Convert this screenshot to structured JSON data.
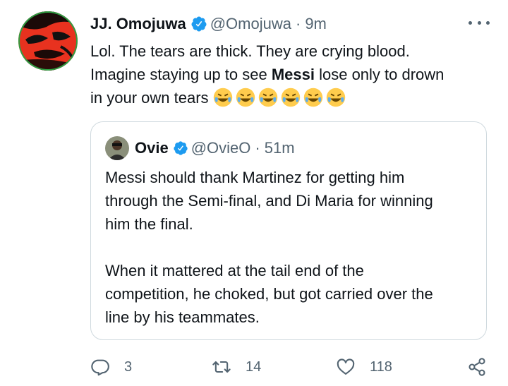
{
  "tweet": {
    "author_name": "JJ. Omojuwa",
    "handle": "@Omojuwa",
    "separator": "·",
    "time": "9m",
    "text_line1": "Lol. The tears are thick. They are crying blood.",
    "text_line2_pre": "Imagine staying up to see ",
    "text_line2_bold": "Messi",
    "text_line2_post": " lose only to drown",
    "text_line3": "in your own tears",
    "emojis": "😂😂😂😂😂😂"
  },
  "quote": {
    "author_name": "Ovie",
    "handle": "@OvieO",
    "separator": "·",
    "time": "51m",
    "p1_line1": "Messi should thank Martinez for getting him",
    "p1_line2": "through the Semi-final, and Di Maria for winning",
    "p1_line3": "him the final.",
    "p2_line1": "When it mattered at the tail end of the",
    "p2_line2": "competition, he choked, but got carried over the",
    "p2_line3": "line by his teammates."
  },
  "actions": {
    "replies": "3",
    "retweets": "14",
    "likes": "118"
  },
  "colors": {
    "verified": "#1d9bf0",
    "muted": "#536471",
    "border": "#cfd9de"
  },
  "icons": [
    "verified-badge-icon",
    "more-icon",
    "reply-icon",
    "retweet-icon",
    "like-icon",
    "share-icon"
  ]
}
